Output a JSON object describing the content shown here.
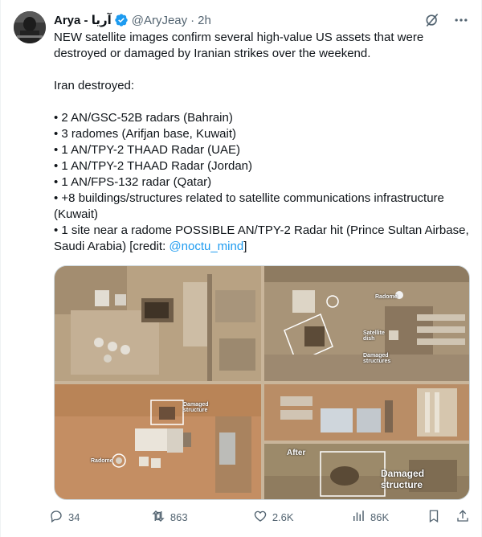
{
  "author": {
    "name": "Arya - آریا",
    "handle": "@AryJeay",
    "separator": "·",
    "time": "2h"
  },
  "tweet": {
    "lines": [
      "NEW satellite images confirm several high-value US assets that were destroyed or damaged by Iranian strikes over the weekend.",
      "",
      "Iran destroyed:",
      "",
      "• 2 AN/GSC-52B radars (Bahrain)",
      "• 3 radomes (Arifjan base, Kuwait)",
      "• 1 AN/TPY-2 THAAD Radar (UAE)",
      "• 1 AN/TPY-2 THAAD Radar (Jordan)",
      "• 1 AN/FPS-132 radar (Qatar)",
      "• +8 buildings/structures related to satellite communications infrastructure (Kuwait)"
    ],
    "last_line_prefix": "• 1 site near a radome POSSIBLE AN/TPY-2 Radar hit (Prince Sultan Airbase, Saudi Arabia) [credit: ",
    "credit_link": "@noctu_mind",
    "last_line_suffix": "]"
  },
  "media": {
    "captions": {
      "radome_tr": "Radome",
      "satellite_dish": "Satellite dish",
      "damaged_structures": "Damaged structures",
      "damaged_structure_bl": "Damaged structure",
      "radome_bl": "Radome",
      "after": "After",
      "damaged_structure_big": "Damaged structure"
    }
  },
  "actions": {
    "replies": "34",
    "reposts": "863",
    "likes": "2.6K",
    "views": "86K"
  },
  "icons": {
    "verified": "verified-badge-icon",
    "grok": "grok-icon",
    "more": "more-dots-icon",
    "reply": "reply-icon",
    "repost": "repost-icon",
    "like": "heart-icon",
    "views": "views-icon",
    "bookmark": "bookmark-icon",
    "share": "share-icon"
  },
  "colors": {
    "accent": "#1d9bf0",
    "text": "#0f1419",
    "secondary": "#536471"
  }
}
